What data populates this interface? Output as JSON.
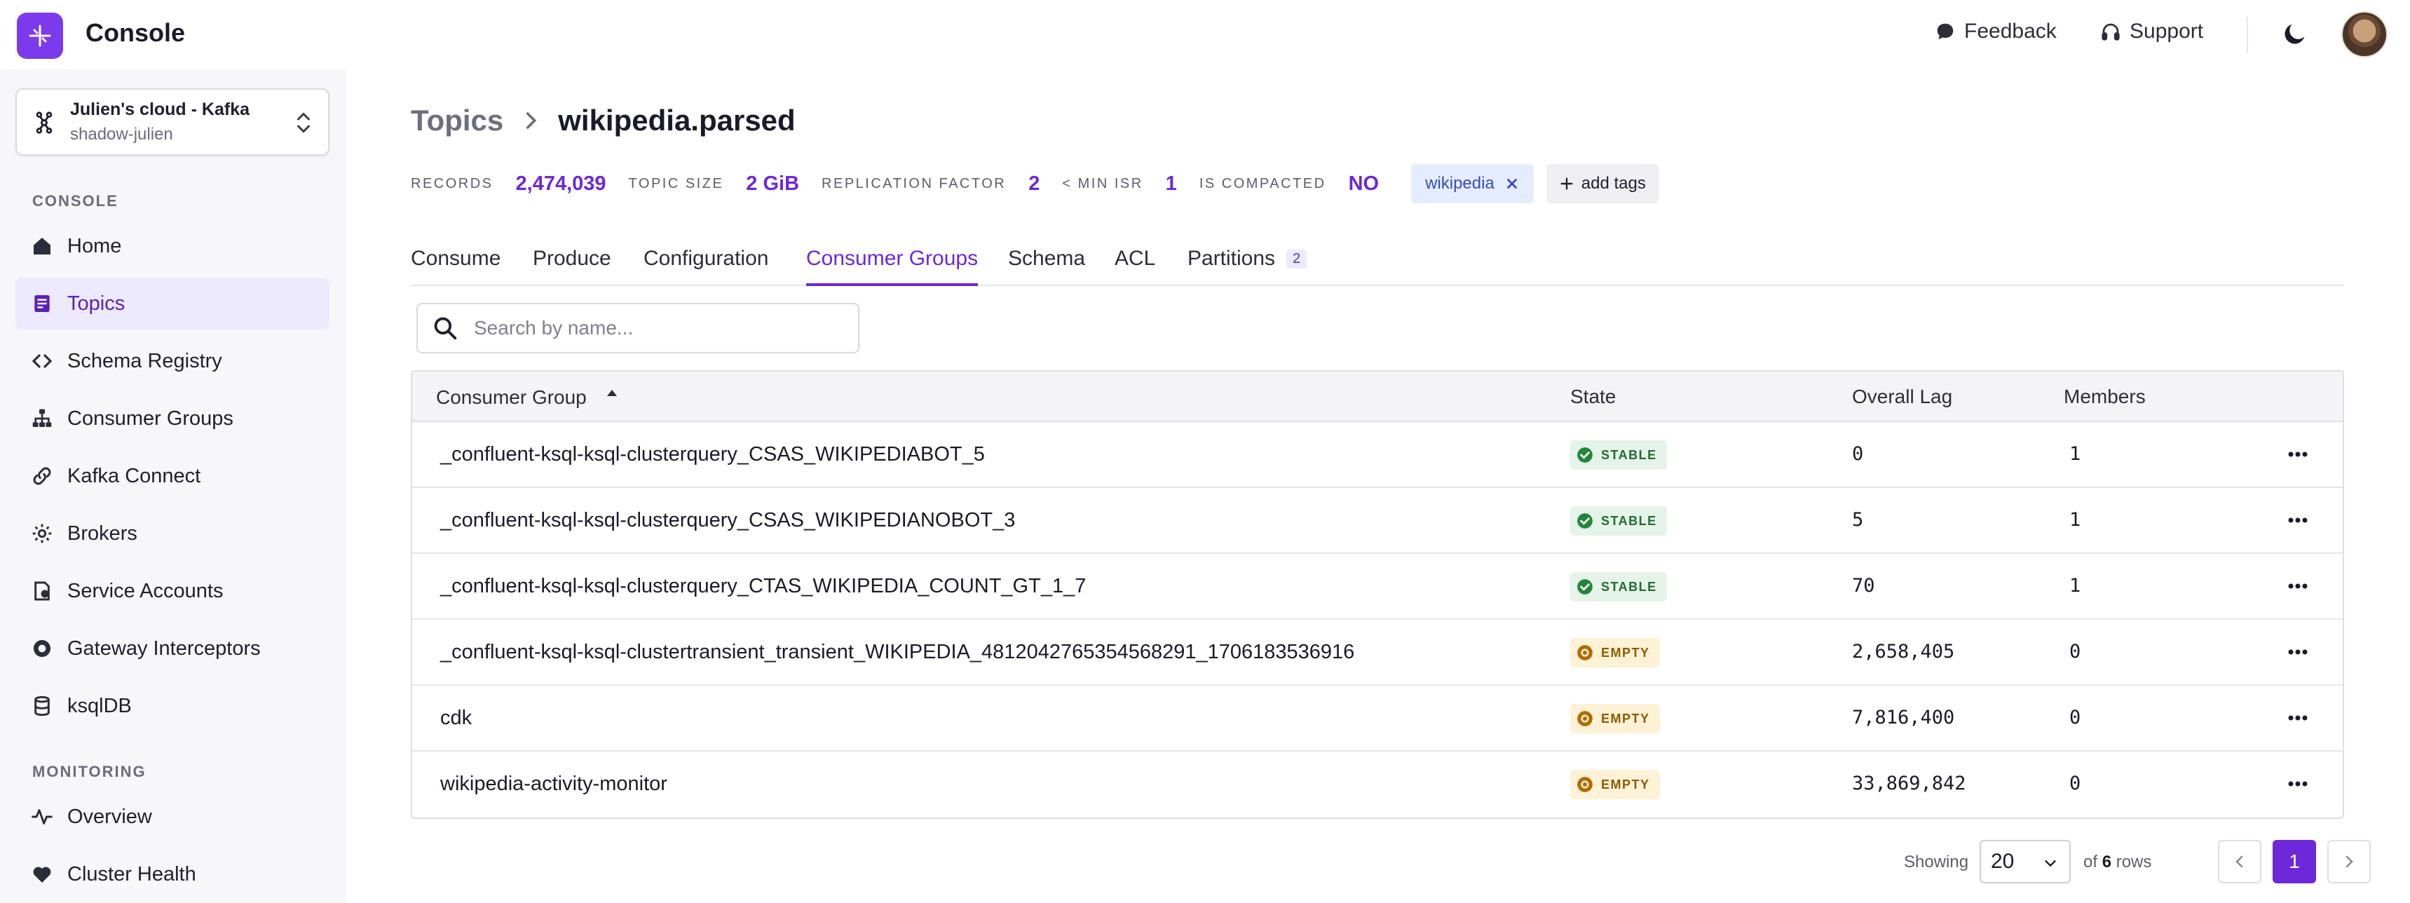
{
  "app": {
    "title": "Console"
  },
  "topbar": {
    "feedback_label": "Feedback",
    "support_label": "Support"
  },
  "sidebar": {
    "cluster": {
      "name": "Julien's cloud - Kafka",
      "sub": "shadow-julien"
    },
    "console_section": "CONSOLE",
    "items": [
      {
        "label": "Home",
        "icon": "home-icon"
      },
      {
        "label": "Topics",
        "icon": "topics-icon",
        "active": true
      },
      {
        "label": "Schema Registry",
        "icon": "code-icon"
      },
      {
        "label": "Consumer Groups",
        "icon": "consumer-groups-icon"
      },
      {
        "label": "Kafka Connect",
        "icon": "link-icon"
      },
      {
        "label": "Brokers",
        "icon": "cog-icon"
      },
      {
        "label": "Service Accounts",
        "icon": "service-account-icon"
      },
      {
        "label": "Gateway Interceptors",
        "icon": "gateway-icon"
      },
      {
        "label": "ksqlDB",
        "icon": "database-icon"
      }
    ],
    "monitoring_section": "MONITORING",
    "monitoring_items": [
      {
        "label": "Overview",
        "icon": "activity-icon"
      },
      {
        "label": "Cluster Health",
        "icon": "heart-icon"
      }
    ]
  },
  "breadcrumb": {
    "parent": "Topics",
    "current": "wikipedia.parsed"
  },
  "stats": {
    "records_label": "RECORDS",
    "records_value": "2,474,039",
    "size_label": "TOPIC SIZE",
    "size_value": "2 GiB",
    "replication_label": "REPLICATION FACTOR",
    "replication_value": "2",
    "min_isr_label": "< MIN ISR",
    "min_isr_value": "1",
    "compacted_label": "IS COMPACTED",
    "compacted_value": "NO"
  },
  "tags": {
    "items": [
      "wikipedia"
    ],
    "add_label": "add tags"
  },
  "tabs": [
    {
      "label": "Consume"
    },
    {
      "label": "Produce"
    },
    {
      "label": "Configuration"
    },
    {
      "label": "Consumer Groups",
      "active": true
    },
    {
      "label": "Schema"
    },
    {
      "label": "ACL"
    },
    {
      "label": "Partitions",
      "badge": "2"
    }
  ],
  "search": {
    "placeholder": "Search by name...",
    "value": ""
  },
  "table": {
    "columns": {
      "group": "Consumer Group",
      "state": "State",
      "lag": "Overall Lag",
      "members": "Members"
    },
    "rows": [
      {
        "group": "_confluent-ksql-ksql-clusterquery_CSAS_WIKIPEDIABOT_5",
        "state": "STABLE",
        "lag": "0",
        "members": "1"
      },
      {
        "group": "_confluent-ksql-ksql-clusterquery_CSAS_WIKIPEDIANOBOT_3",
        "state": "STABLE",
        "lag": "5",
        "members": "1"
      },
      {
        "group": "_confluent-ksql-ksql-clusterquery_CTAS_WIKIPEDIA_COUNT_GT_1_7",
        "state": "STABLE",
        "lag": "70",
        "members": "1"
      },
      {
        "group": "_confluent-ksql-ksql-clustertransient_transient_WIKIPEDIA_4812042765354568291_1706183536916",
        "state": "EMPTY",
        "lag": "2,658,405",
        "members": "0"
      },
      {
        "group": "cdk",
        "state": "EMPTY",
        "lag": "7,816,400",
        "members": "0"
      },
      {
        "group": "wikipedia-activity-monitor",
        "state": "EMPTY",
        "lag": "33,869,842",
        "members": "0"
      }
    ]
  },
  "pagination": {
    "showing_label": "Showing",
    "page_size": "20",
    "of_label": "of",
    "total_rows": "6",
    "rows_label": "rows",
    "current_page": "1"
  },
  "colors": {
    "accent": "#6d28d9",
    "stable_bg": "#e5f3e8",
    "empty_bg": "#fdf2d6"
  }
}
